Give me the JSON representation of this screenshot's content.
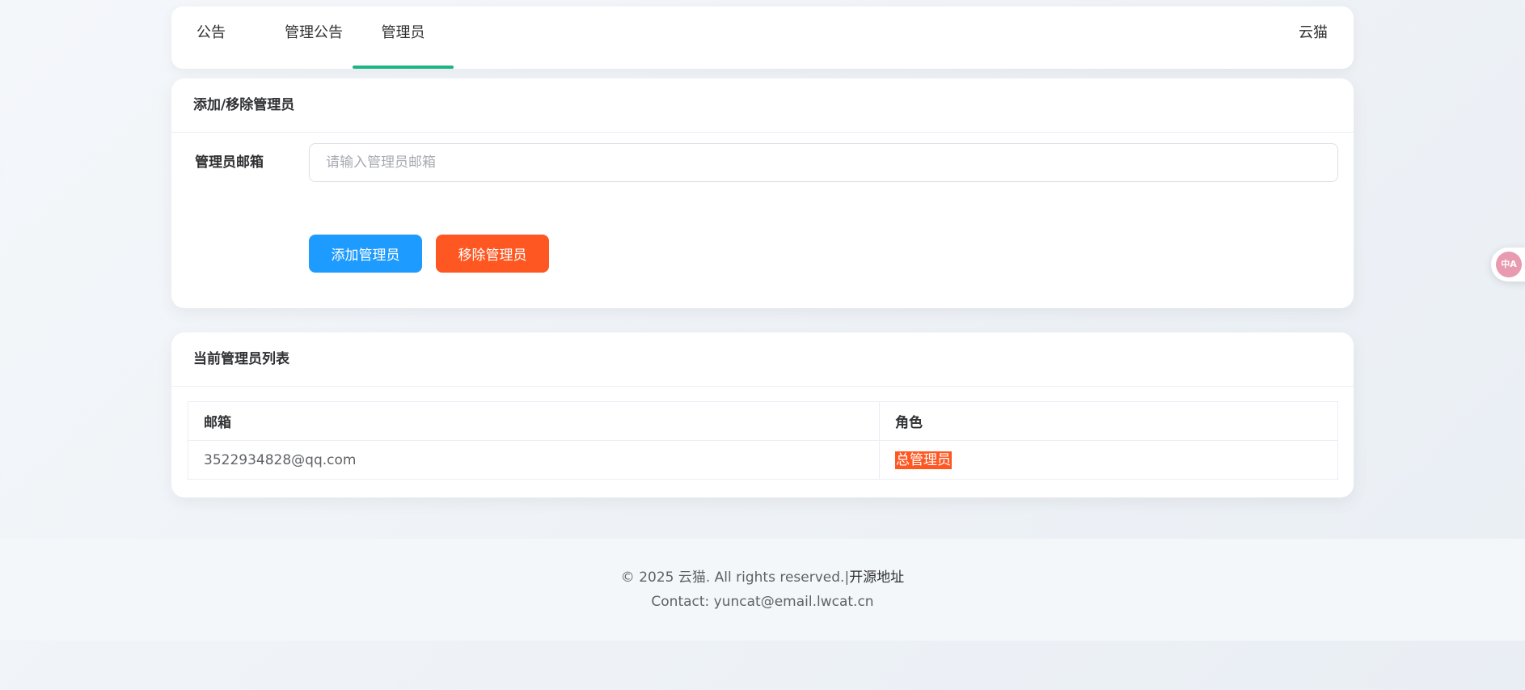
{
  "nav": {
    "tabs": [
      {
        "label": "公告"
      },
      {
        "label": "管理公告"
      },
      {
        "label": "管理员",
        "active": true
      }
    ],
    "user": "云猫",
    "active_color": "#1fb583"
  },
  "admin_form": {
    "title": "添加/移除管理员",
    "email_label": "管理员邮箱",
    "email_placeholder": "请输入管理员邮箱",
    "add_button": "添加管理员",
    "remove_button": "移除管理员",
    "add_color": "#1e9bff",
    "remove_color": "#fe5722"
  },
  "admin_list": {
    "title": "当前管理员列表",
    "columns": [
      "邮箱",
      "角色"
    ],
    "rows": [
      {
        "email": "3522934828@qq.com",
        "role": "总管理员"
      }
    ]
  },
  "footer": {
    "copyright": "© 2025 云猫. All rights reserved.|",
    "source_link": "开源地址",
    "contact": "Contact: yuncat@email.lwcat.cn"
  },
  "translate_fab": {
    "icon": "translate-icon",
    "glyph": "中A"
  }
}
